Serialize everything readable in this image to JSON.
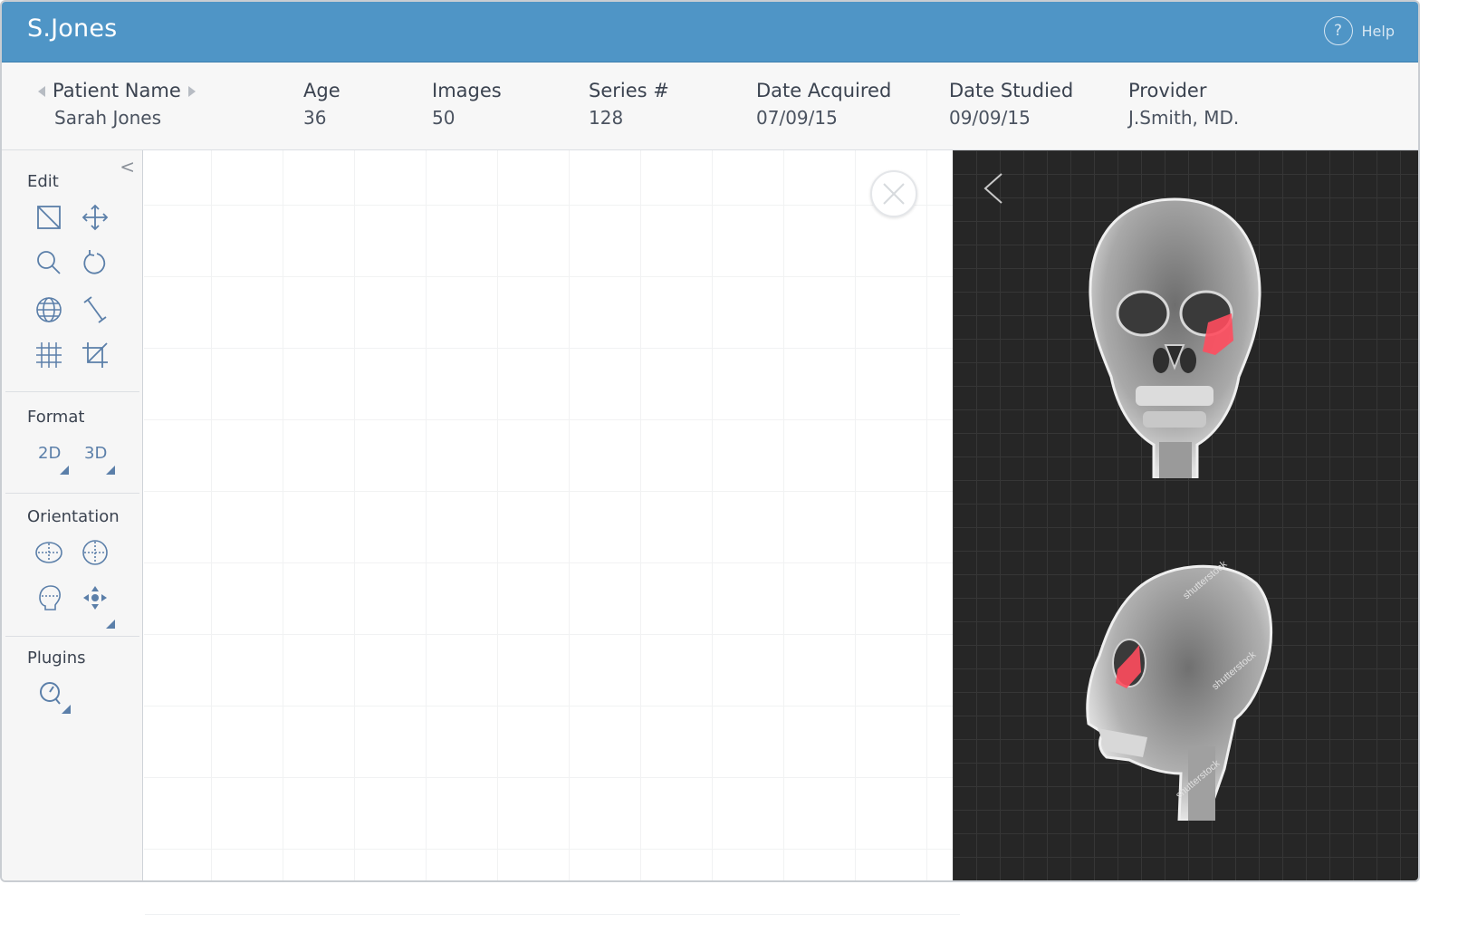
{
  "app": {
    "title": "S.Jones",
    "help_label": "Help",
    "help_glyph": "?"
  },
  "patient": {
    "columns": [
      {
        "label": "Patient Name",
        "value": "Sarah Jones"
      },
      {
        "label": "Age",
        "value": "36"
      },
      {
        "label": "Images",
        "value": "50"
      },
      {
        "label": "Series #",
        "value": "128"
      },
      {
        "label": "Date Acquired",
        "value": "07/09/15"
      },
      {
        "label": "Date Studied",
        "value": "09/09/15"
      },
      {
        "label": "Provider",
        "value": "J.Smith, MD."
      }
    ]
  },
  "sidebar": {
    "collapse_glyph": "<",
    "sections": {
      "edit": {
        "title": "Edit",
        "tools": [
          "select-rect-icon",
          "move-icon",
          "zoom-icon",
          "rotate-icon",
          "globe-icon",
          "measure-icon",
          "grid-icon",
          "crop-icon"
        ]
      },
      "format": {
        "title": "Format",
        "options": [
          "2D",
          "3D"
        ]
      },
      "orientation": {
        "title": "Orientation",
        "tools": [
          "axial-icon",
          "coronal-icon",
          "sagittal-head-icon",
          "pan-arrows-icon"
        ]
      },
      "plugins": {
        "title": "Plugins",
        "tools": [
          "plugin-search-icon"
        ]
      }
    }
  },
  "viewer": {
    "images": [
      {
        "name": "skull-frontal-xray",
        "view": "frontal",
        "highlight_color": "#ff4d5e"
      },
      {
        "name": "skull-lateral-xray",
        "view": "lateral",
        "highlight_color": "#ff4d5e"
      }
    ],
    "watermark": "shutterstock"
  },
  "colors": {
    "header": "#4f95c6",
    "icon": "#5b7fa9",
    "viewer_bg": "#262626",
    "highlight": "#ff4d5e"
  }
}
